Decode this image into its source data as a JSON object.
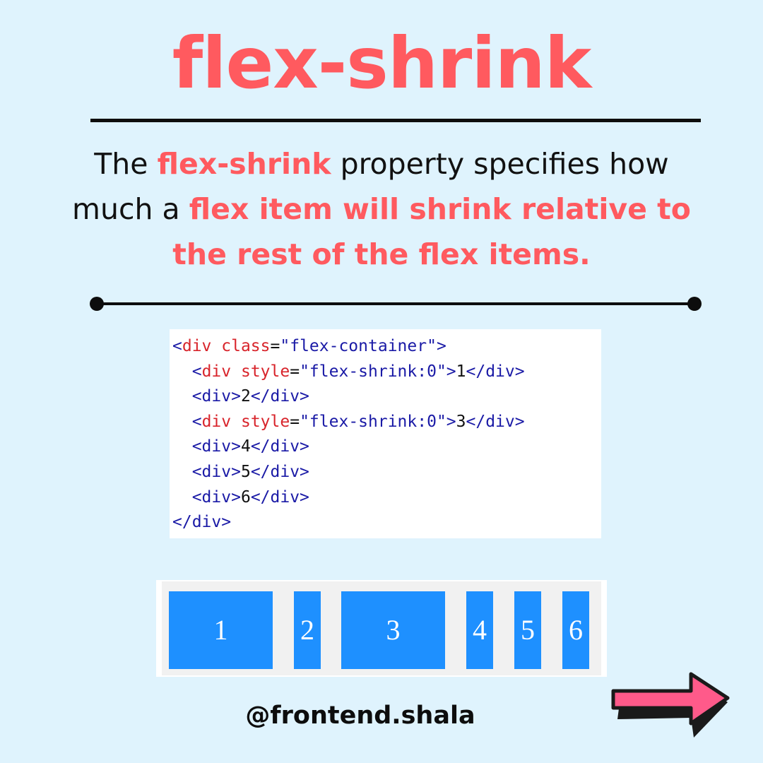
{
  "title": "flex-shrink",
  "description": {
    "part1": "The ",
    "hl1": "flex-shrink",
    "part2": " property specifies how much a ",
    "hl2": "flex item will shrink relative to the rest of the flex items."
  },
  "code": {
    "l1": {
      "lt": "<",
      "tag": "div",
      "sp": " ",
      "attr": "class",
      "eq": "=",
      "val": "\"flex-container\"",
      "gt": ">"
    },
    "l2": {
      "ind": "  ",
      "lt": "<",
      "tag": "div",
      "sp": " ",
      "attr": "style",
      "eq": "=",
      "val": "\"flex-shrink:0\"",
      "gt": ">",
      "text": "1",
      "close": "</div>"
    },
    "l3": {
      "ind": "  ",
      "open": "<div>",
      "text": "2",
      "close": "</div>"
    },
    "l4": {
      "ind": "  ",
      "lt": "<",
      "tag": "div",
      "sp": " ",
      "attr": "style",
      "eq": "=",
      "val": "\"flex-shrink:0\"",
      "gt": ">",
      "text": "3",
      "close": "</div>"
    },
    "l5": {
      "ind": "  ",
      "open": "<div>",
      "text": "4",
      "close": "</div>"
    },
    "l6": {
      "ind": "  ",
      "open": "<div>",
      "text": "5",
      "close": "</div>"
    },
    "l7": {
      "ind": "  ",
      "open": "<div>",
      "text": "6",
      "close": "</div>"
    },
    "l8": {
      "close": "</div>"
    }
  },
  "demo": {
    "items": [
      {
        "label": "1",
        "flex_shrink": 0
      },
      {
        "label": "2",
        "flex_shrink": 1
      },
      {
        "label": "3",
        "flex_shrink": 0
      },
      {
        "label": "4",
        "flex_shrink": 1
      },
      {
        "label": "5",
        "flex_shrink": 1
      },
      {
        "label": "6",
        "flex_shrink": 1
      }
    ]
  },
  "handle": "@frontend.shala",
  "arrow_icon": "right-arrow-icon",
  "colors": {
    "background": "#dff3fd",
    "accent": "#ff5a5f",
    "flex_item": "#1e90ff",
    "arrow_fill": "#ff5a8a"
  }
}
